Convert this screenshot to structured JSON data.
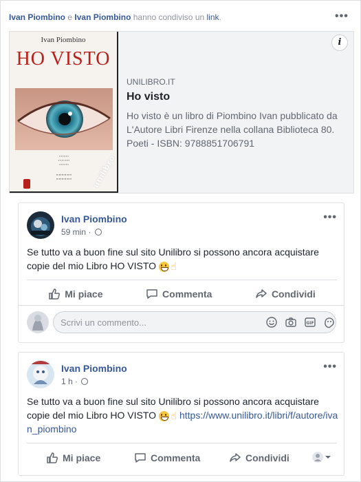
{
  "share": {
    "user1": "Ivan Piombino",
    "conj": "e",
    "user2": "Ivan Piombino",
    "action": "hanno condiviso un",
    "link_word": "link",
    "period": "."
  },
  "link_preview": {
    "domain": "UNILIBRO.IT",
    "title": "Ho visto",
    "description": "Ho visto è un libro di Piombino Ivan pubblicato da L'Autore Libri Firenze nella collana Biblioteca 80. Poeti - ISBN: 9788851706791",
    "cover_author": "Ivan Piombino",
    "cover_title": "HO VISTO",
    "info_label": "i",
    "watermark": "unilibro"
  },
  "posts": [
    {
      "author": "Ivan Piombino",
      "time": "59 min ·",
      "text": "Se tutto va a buon fine sul sito Unilibro si possono ancora acquistare copie del mio Libro HO VISTO",
      "link": "",
      "actions": {
        "like": "Mi piace",
        "comment": "Commenta",
        "share": "Condividi"
      },
      "comment_placeholder": "Scrivi un commento..."
    },
    {
      "author": "Ivan Piombino",
      "time": "1 h ·",
      "text": "Se tutto va a buon fine sul sito Unilibro si possono ancora acquistare copie del mio Libro HO VISTO",
      "link": "https://www.unilibro.it/libri/f/autore/ivan_piombino",
      "actions": {
        "like": "Mi piace",
        "comment": "Commenta",
        "share": "Condividi"
      }
    }
  ],
  "colors": {
    "link": "#365899",
    "secondary": "#606770",
    "border": "#dddfe2",
    "accent_red": "#b8211b"
  },
  "icons": [
    "more-dots-icon",
    "info-icon",
    "globe-icon",
    "like-icon",
    "comment-icon",
    "share-icon",
    "emoji-icon",
    "camera-icon",
    "gif-icon",
    "sticker-icon",
    "dropdown-icon"
  ]
}
